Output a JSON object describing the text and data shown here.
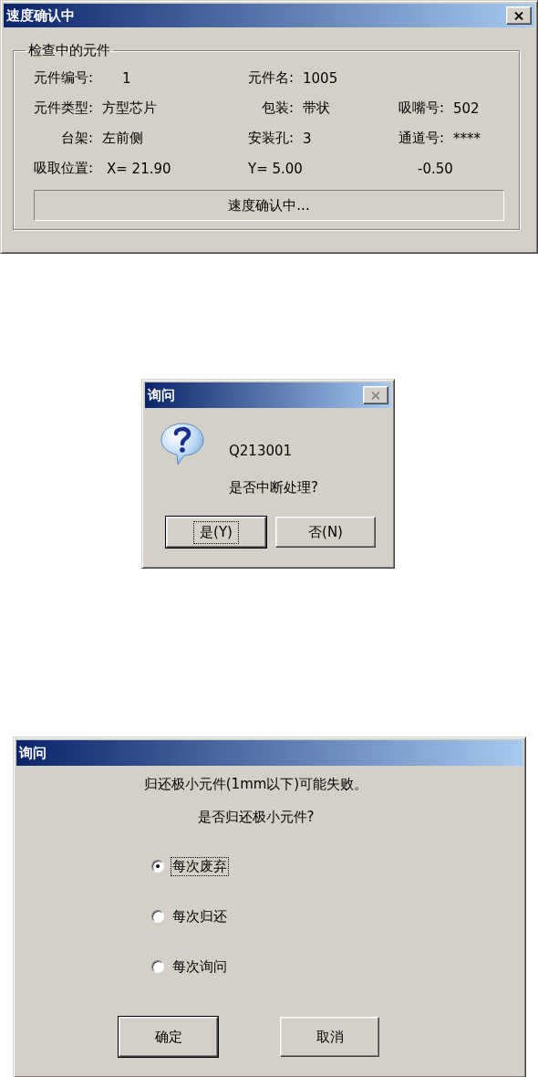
{
  "dialogs": [
    {
      "kind": "progress",
      "title": "速度确认中",
      "close_button": {
        "disabled": false
      },
      "group_title": "检查中的元件",
      "rows": [
        [
          {
            "label": "元件编号:",
            "value": "1"
          },
          {
            "label": "元件名:",
            "value": "1005"
          }
        ],
        [
          {
            "label": "元件类型:",
            "value": "方型芯片"
          },
          {
            "label": "包装:",
            "value": "带状"
          },
          {
            "label": "吸嘴号:",
            "value": "502"
          }
        ],
        [
          {
            "label": "台架:",
            "value": "左前侧"
          },
          {
            "label": "安装孔:",
            "value": "3"
          },
          {
            "label": "通道号:",
            "value": "****"
          }
        ]
      ],
      "pick_position": {
        "label": "吸取位置:",
        "x": "X= 21.90",
        "y": "Y= 5.00",
        "value_3": "-0.50"
      },
      "status": "速度确认中..."
    },
    {
      "kind": "question",
      "title": "询问",
      "close_button": {
        "disabled": true
      },
      "code": "Q213001",
      "message": "是否中断处理?",
      "buttons": [
        {
          "label": "是(Y)",
          "default": true,
          "focused": true
        },
        {
          "label": "否(N)",
          "default": false,
          "focused": false
        }
      ]
    },
    {
      "kind": "options",
      "title": "询问",
      "messages": [
        "归还极小元件(1mm以下)可能失败。",
        "是否归还极小元件?"
      ],
      "options": [
        {
          "label": "每次废弃",
          "selected": true,
          "focused": true
        },
        {
          "label": "每次归还",
          "selected": false,
          "focused": false
        },
        {
          "label": "每次询问",
          "selected": false,
          "focused": false
        }
      ],
      "buttons": [
        {
          "label": "确定",
          "default": true,
          "focused": false
        },
        {
          "label": "取消",
          "default": false,
          "focused": false
        }
      ]
    }
  ]
}
